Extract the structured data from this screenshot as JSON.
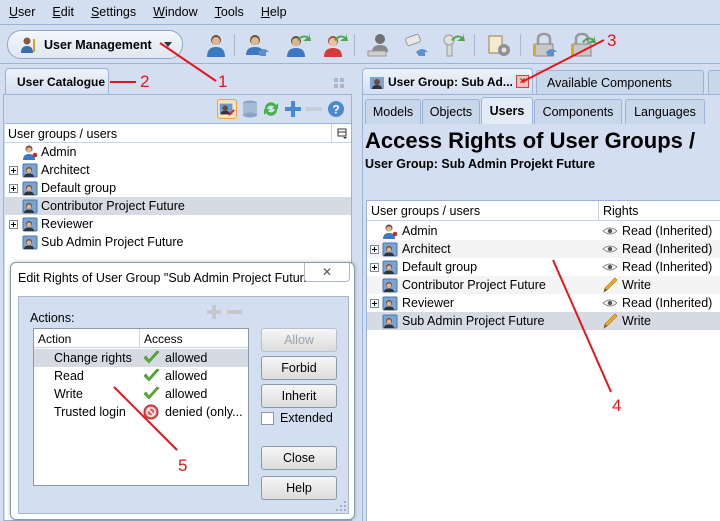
{
  "menubar": {
    "items": [
      {
        "label": "User",
        "mnemonic": "U"
      },
      {
        "label": "Edit",
        "mnemonic": "E"
      },
      {
        "label": "Settings",
        "mnemonic": "S"
      },
      {
        "label": "Window",
        "mnemonic": "W"
      },
      {
        "label": "Tools",
        "mnemonic": "T"
      },
      {
        "label": "Help",
        "mnemonic": "H"
      }
    ]
  },
  "toolbar": {
    "mode_selector": "User Management",
    "icons": [
      "new-user-icon",
      "import-user-icon",
      "reset-user-icon",
      "revert-user-icon",
      "user-key-icon",
      "import-key-icon",
      "revert-key-icon",
      "config-settings-icon",
      "import-lock-icon",
      "revert-lock-icon"
    ]
  },
  "left": {
    "tab_label": "User Catalogue",
    "tree_header": "User groups / users",
    "tools": [
      "edit-rights-icon",
      "database-icon",
      "refresh-icon",
      "add-icon",
      "remove-icon",
      "help-icon"
    ],
    "tree": [
      {
        "label": "Admin",
        "type": "user",
        "expandable": false,
        "selected": false
      },
      {
        "label": "Architect",
        "type": "group",
        "expandable": true,
        "selected": false
      },
      {
        "label": "Default group",
        "type": "group",
        "expandable": true,
        "selected": false
      },
      {
        "label": "Contributor Project Future",
        "type": "group",
        "expandable": false,
        "selected": true
      },
      {
        "label": "Reviewer",
        "type": "group",
        "expandable": true,
        "selected": false
      },
      {
        "label": "Sub Admin Project Future",
        "type": "group",
        "expandable": false,
        "selected": false
      }
    ]
  },
  "dialog": {
    "title": "Edit Rights of User Group \"Sub Admin Project Futur...",
    "close": "✕",
    "actions_label": "Actions:",
    "columns": [
      "Action",
      "Access"
    ],
    "rows": [
      {
        "action": "Change rights",
        "access": "allowed",
        "status": "allowed",
        "selected": true
      },
      {
        "action": "Read",
        "access": "allowed",
        "status": "allowed",
        "selected": false
      },
      {
        "action": "Write",
        "access": "allowed",
        "status": "allowed",
        "selected": false
      },
      {
        "action": "Trusted login",
        "access": "denied (only...",
        "status": "denied",
        "selected": false
      }
    ],
    "buttons": {
      "allow": "Allow",
      "forbid": "Forbid",
      "inherit": "Inherit",
      "close": "Close",
      "help": "Help"
    },
    "extended_label": "Extended",
    "extended_checked": false
  },
  "right": {
    "tabs": [
      {
        "label": "User Group: Sub Ad...",
        "active": true,
        "closable": true
      },
      {
        "label": "Available Components",
        "active": false
      }
    ],
    "sub_tabs": [
      {
        "label": "Models",
        "active": false
      },
      {
        "label": "Objects",
        "active": false
      },
      {
        "label": "Users",
        "active": true
      },
      {
        "label": "Components",
        "active": false
      },
      {
        "label": "Languages",
        "active": false
      }
    ],
    "page_title": "Access Rights of User Groups /",
    "page_subtitle": "User Group: Sub Admin Projekt Future",
    "columns": [
      "User groups / users",
      "Rights"
    ],
    "rows": [
      {
        "label": "Admin",
        "type": "user",
        "expandable": false,
        "right": "Read (Inherited)",
        "right_icon": "eye-icon"
      },
      {
        "label": "Architect",
        "type": "group",
        "expandable": true,
        "right": "Read (Inherited)",
        "right_icon": "eye-icon"
      },
      {
        "label": "Default group",
        "type": "group",
        "expandable": true,
        "right": "Read (Inherited)",
        "right_icon": "eye-icon"
      },
      {
        "label": "Contributor Project Future",
        "type": "group",
        "expandable": false,
        "right": "Write",
        "right_icon": "pencil-icon"
      },
      {
        "label": "Reviewer",
        "type": "group",
        "expandable": true,
        "right": "Read (Inherited)",
        "right_icon": "eye-icon"
      },
      {
        "label": "Sub Admin Project Future",
        "type": "group",
        "expandable": false,
        "right": "Write",
        "right_icon": "pencil-icon",
        "selected": true
      }
    ]
  },
  "annotations": [
    "1",
    "2",
    "3",
    "4",
    "5"
  ],
  "colors": {
    "annotation": "#e8141c",
    "background": "#d3dff0",
    "selection": "#d6dbe3"
  }
}
